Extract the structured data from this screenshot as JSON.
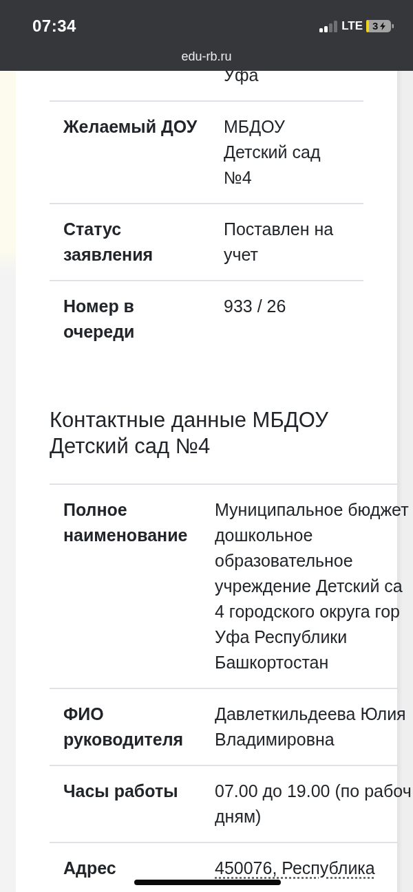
{
  "status_bar": {
    "time": "07:34",
    "network": "LTE",
    "battery": "3"
  },
  "address_bar": {
    "url": "edu-rb.ru"
  },
  "application_table": {
    "rows": [
      {
        "value_lines": [
          "Уфа"
        ]
      },
      {
        "label": "Желаемый ДОУ",
        "value_lines": [
          "МБДОУ",
          "Детский сад",
          "№4"
        ]
      },
      {
        "label": "Статус заявления",
        "value_lines": [
          "Поставлен на",
          "учет"
        ]
      },
      {
        "label": "Номер в очереди",
        "value_lines": [
          "933 / 26"
        ]
      }
    ]
  },
  "contacts": {
    "title": "Контактные данные МБДОУ Детский сад №4",
    "rows": [
      {
        "kind": "text",
        "label": "Полное наименование",
        "value_lines": [
          "Муниципальное бюджет",
          "дошкольное",
          "образовательное",
          "учреждение Детский са",
          "4 городского округа гор",
          "Уфа Республики",
          "Башкортостан"
        ]
      },
      {
        "kind": "text",
        "label": "ФИО руководителя",
        "value_lines": [
          "Давлеткильдеева Юлия",
          "Владимировна"
        ]
      },
      {
        "kind": "text",
        "label": "Часы работы",
        "value_lines": [
          "07.00 до 19.00 (по рабоч",
          "дням)"
        ]
      },
      {
        "kind": "link",
        "label": "Адрес",
        "value_lines": [
          "450076, Республика"
        ]
      }
    ]
  }
}
